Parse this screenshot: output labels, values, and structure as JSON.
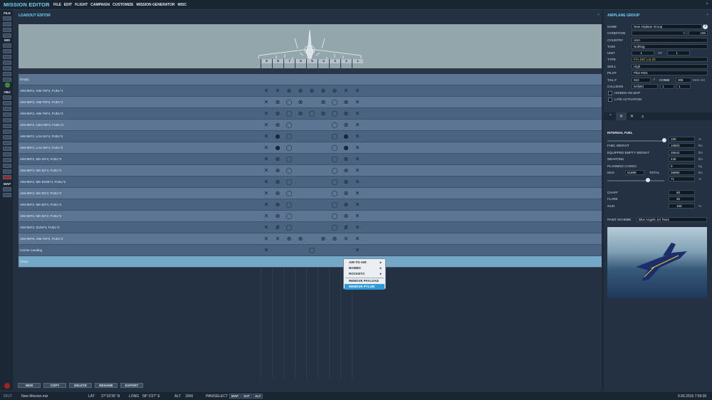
{
  "app": {
    "title": "MISSION EDITOR",
    "close_glyph": "×"
  },
  "menu": [
    "FILE",
    "EDIT",
    "FLIGHT",
    "CAMPAIGN",
    "CUSTOMIZE",
    "MISSION GENERATOR",
    "MISC"
  ],
  "left_toolbar": {
    "sections": [
      "FILE",
      "MIS",
      "OBJ",
      "MAP"
    ]
  },
  "loadout": {
    "title": "LOADOUT EDITOR",
    "close_glyph": "×",
    "pylons": [
      "9",
      "8",
      "7",
      "6",
      "5",
      "4",
      "3",
      "2",
      "1"
    ],
    "rows": [
      {
        "name": "Empty",
        "cells": [
          "",
          "",
          "",
          "",
          "",
          "",
          "",
          "",
          ""
        ]
      },
      {
        "name": "AIM-9M*2, AIM-7M*2, FUEL*1",
        "cells": [
          "x",
          "x",
          "b",
          "b",
          "b",
          "b",
          "b",
          "x",
          "x"
        ]
      },
      {
        "name": "AIM-9M*2, AIM-7M*2, FUEL*2",
        "cells": [
          "x",
          "b",
          "o",
          "b",
          "",
          "b",
          "o",
          "b",
          "x"
        ]
      },
      {
        "name": "AIM-9M*2, AIM-7M*4, FUEL*3",
        "cells": [
          "x",
          "b",
          "o",
          "b",
          "o",
          "b",
          "o",
          "b",
          "x"
        ]
      },
      {
        "name": "AIM-9M*2, CBU-99*4, FUEL*2",
        "cells": [
          "x",
          "c",
          "o",
          "",
          "",
          "",
          "o",
          "c",
          "x"
        ]
      },
      {
        "name": "AIM-9M*2, LAU-61*4, FUEL*2",
        "cells": [
          "x",
          "d",
          "o",
          "",
          "",
          "",
          "o",
          "d",
          "x"
        ]
      },
      {
        "name": "AIM-9M*2, LAU-68*4, FUEL*2",
        "cells": [
          "x",
          "d",
          "o",
          "",
          "",
          "",
          "o",
          "d",
          "x"
        ]
      },
      {
        "name": "AIM-9M*2, MK-20*4, FUEL*2",
        "cells": [
          "x",
          "c",
          "o",
          "",
          "",
          "",
          "o",
          "c",
          "x"
        ]
      },
      {
        "name": "AIM-9M*2, MK-82*4, FUEL*2",
        "cells": [
          "x",
          "c",
          "o",
          "",
          "",
          "",
          "o",
          "c",
          "x"
        ]
      },
      {
        "name": "AIM-9M*2, MK-82SE*4, FUEL*2",
        "cells": [
          "x",
          "c",
          "o",
          "",
          "",
          "",
          "o",
          "c",
          "x"
        ]
      },
      {
        "name": "AIM-9M*2, MK-83*2, FUEL*2",
        "cells": [
          "x",
          "c",
          "o",
          "",
          "",
          "",
          "o",
          "c",
          "x"
        ]
      },
      {
        "name": "AIM-9M*2, MK-83*4, FUEL*2",
        "cells": [
          "x",
          "c",
          "o",
          "",
          "",
          "",
          "o",
          "c",
          "x"
        ]
      },
      {
        "name": "AIM-9M*2, MK-84*2, FUEL*2",
        "cells": [
          "x",
          "c",
          "o",
          "",
          "",
          "",
          "o",
          "c",
          "x"
        ]
      },
      {
        "name": "AIM-9M*2, ZUNI*4, FUEL*2",
        "cells": [
          "x",
          "h",
          "o",
          "",
          "",
          "",
          "o",
          "h",
          "x"
        ]
      },
      {
        "name": "AIM-9M*6, AIM-7M*2, FUEL*2",
        "cells": [
          "x",
          "x",
          "b",
          "b",
          "",
          "b",
          "b",
          "x",
          "x"
        ]
      },
      {
        "name": "Carrier Landing",
        "cells": [
          "x",
          "",
          "",
          "",
          "o",
          "",
          "",
          "",
          "x"
        ]
      },
      {
        "name": "Clean",
        "cells": [
          "",
          "",
          "",
          "",
          "",
          "",
          "",
          "",
          ""
        ]
      }
    ],
    "buttons": [
      "NEW",
      "COPY",
      "DELETE",
      "RENAME",
      "EXPORT"
    ]
  },
  "context_menu": {
    "items": [
      {
        "label": "AIR-TO-AIR",
        "submenu": true
      },
      {
        "label": "BOMBS",
        "submenu": true
      },
      {
        "label": "ROCKETS",
        "submenu": true
      },
      {
        "label": "REMOVE PAYLOAD",
        "submenu": false
      },
      {
        "label": "REMOVE PYLON",
        "submenu": false,
        "highlighted": true
      }
    ],
    "submenu_glyph": "▸"
  },
  "group": {
    "title": "AIRPLANE GROUP",
    "close_glyph": "×",
    "name_label": "NAME",
    "name_value": "New Airplane Group",
    "help_glyph": "?",
    "condition_label": "CONDITION",
    "condition_unit": "%",
    "condition_value": "100",
    "country_label": "COUNTRY",
    "country_value": "USA",
    "task_label": "TASK",
    "task_value": "Nothing",
    "unit_label": "UNIT",
    "unit_value": "1",
    "unit_of_label": "OF",
    "unit_of_value": "1",
    "type_label": "TYPE",
    "type_value": "F/A-18C Lot 20",
    "skill_label": "SKILL",
    "skill_value": "High",
    "pilot_label": "PILOT",
    "pilot_value": "Pilot #001",
    "tail_label": "TAIL #",
    "tail_value": "010",
    "comm_label": "COMM",
    "comm_value": "305",
    "comm_unit": "MHz AM",
    "callsign_label": "CALLSIGN",
    "callsign_value": "Enfield",
    "callsign_num1": "1",
    "callsign_num2": "1",
    "hidden_label": "HIDDEN ON MAP",
    "late_label": "LATE ACTIVATION"
  },
  "fuel": {
    "section_title": "INTERNAL FUEL",
    "percent_value": "100",
    "percent_unit": "%",
    "fraction": 1.0,
    "fuel_weight_label": "FUEL WEIGHT",
    "fuel_weight": "10803",
    "empty_weight_label": "EQUIPPED EMPTY WEIGHT",
    "empty_weight": "25642",
    "weapons_label": "WEAPONS",
    "weapons": "445",
    "cargo_label": "PLANNING CARGO",
    "cargo": "0",
    "cargo_unit": "kg",
    "max_label": "MAX",
    "max_value": "51899",
    "total_label": "TOTAL",
    "total_value": "36890",
    "weight_unit": "lbs",
    "load_percent": "71",
    "load_fraction": 0.71,
    "chaff_label": "CHAFF",
    "chaff": "60",
    "flare_label": "FLARE",
    "flare": "30",
    "gun_label": "GUN",
    "gun": "100",
    "gun_unit": "%",
    "paint_label": "PAINT SCHEME",
    "paint_value": "Blue Angels Jet Team"
  },
  "status": {
    "mode": "DFLT",
    "file": "New Mission.miz",
    "lat_label": "LAT",
    "lat": "27°16'35\" N",
    "long_label": "LONG",
    "long": "58° 6'27\" E",
    "alt_label": "ALT",
    "alt": "1506",
    "pan_label": "PAN/SELECT",
    "map_buttons": [
      "MAP",
      "SAT",
      "ALT"
    ],
    "datetime": "9.06.2016 7:59:30"
  },
  "colors": {
    "accent": "#6fd0f2",
    "row_a": "#5c7592",
    "row_b": "#4a6380",
    "row_selected": "#73a9c6",
    "menu_highlight": "#2f9ad6"
  }
}
